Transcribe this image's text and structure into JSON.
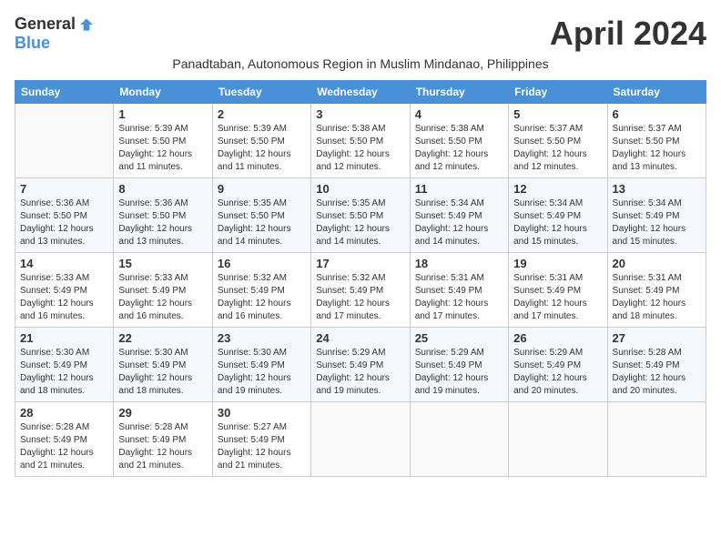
{
  "logo": {
    "general": "General",
    "blue": "Blue"
  },
  "header": {
    "month": "April 2024",
    "subtitle": "Panadtaban, Autonomous Region in Muslim Mindanao, Philippines"
  },
  "weekdays": [
    "Sunday",
    "Monday",
    "Tuesday",
    "Wednesday",
    "Thursday",
    "Friday",
    "Saturday"
  ],
  "weeks": [
    [
      null,
      {
        "day": 1,
        "sunrise": "5:39 AM",
        "sunset": "5:50 PM",
        "daylight": "12 hours and 11 minutes."
      },
      {
        "day": 2,
        "sunrise": "5:39 AM",
        "sunset": "5:50 PM",
        "daylight": "12 hours and 11 minutes."
      },
      {
        "day": 3,
        "sunrise": "5:38 AM",
        "sunset": "5:50 PM",
        "daylight": "12 hours and 12 minutes."
      },
      {
        "day": 4,
        "sunrise": "5:38 AM",
        "sunset": "5:50 PM",
        "daylight": "12 hours and 12 minutes."
      },
      {
        "day": 5,
        "sunrise": "5:37 AM",
        "sunset": "5:50 PM",
        "daylight": "12 hours and 12 minutes."
      },
      {
        "day": 6,
        "sunrise": "5:37 AM",
        "sunset": "5:50 PM",
        "daylight": "12 hours and 13 minutes."
      }
    ],
    [
      {
        "day": 7,
        "sunrise": "5:36 AM",
        "sunset": "5:50 PM",
        "daylight": "12 hours and 13 minutes."
      },
      {
        "day": 8,
        "sunrise": "5:36 AM",
        "sunset": "5:50 PM",
        "daylight": "12 hours and 13 minutes."
      },
      {
        "day": 9,
        "sunrise": "5:35 AM",
        "sunset": "5:50 PM",
        "daylight": "12 hours and 14 minutes."
      },
      {
        "day": 10,
        "sunrise": "5:35 AM",
        "sunset": "5:50 PM",
        "daylight": "12 hours and 14 minutes."
      },
      {
        "day": 11,
        "sunrise": "5:34 AM",
        "sunset": "5:49 PM",
        "daylight": "12 hours and 14 minutes."
      },
      {
        "day": 12,
        "sunrise": "5:34 AM",
        "sunset": "5:49 PM",
        "daylight": "12 hours and 15 minutes."
      },
      {
        "day": 13,
        "sunrise": "5:34 AM",
        "sunset": "5:49 PM",
        "daylight": "12 hours and 15 minutes."
      }
    ],
    [
      {
        "day": 14,
        "sunrise": "5:33 AM",
        "sunset": "5:49 PM",
        "daylight": "12 hours and 16 minutes."
      },
      {
        "day": 15,
        "sunrise": "5:33 AM",
        "sunset": "5:49 PM",
        "daylight": "12 hours and 16 minutes."
      },
      {
        "day": 16,
        "sunrise": "5:32 AM",
        "sunset": "5:49 PM",
        "daylight": "12 hours and 16 minutes."
      },
      {
        "day": 17,
        "sunrise": "5:32 AM",
        "sunset": "5:49 PM",
        "daylight": "12 hours and 17 minutes."
      },
      {
        "day": 18,
        "sunrise": "5:31 AM",
        "sunset": "5:49 PM",
        "daylight": "12 hours and 17 minutes."
      },
      {
        "day": 19,
        "sunrise": "5:31 AM",
        "sunset": "5:49 PM",
        "daylight": "12 hours and 17 minutes."
      },
      {
        "day": 20,
        "sunrise": "5:31 AM",
        "sunset": "5:49 PM",
        "daylight": "12 hours and 18 minutes."
      }
    ],
    [
      {
        "day": 21,
        "sunrise": "5:30 AM",
        "sunset": "5:49 PM",
        "daylight": "12 hours and 18 minutes."
      },
      {
        "day": 22,
        "sunrise": "5:30 AM",
        "sunset": "5:49 PM",
        "daylight": "12 hours and 18 minutes."
      },
      {
        "day": 23,
        "sunrise": "5:30 AM",
        "sunset": "5:49 PM",
        "daylight": "12 hours and 19 minutes."
      },
      {
        "day": 24,
        "sunrise": "5:29 AM",
        "sunset": "5:49 PM",
        "daylight": "12 hours and 19 minutes."
      },
      {
        "day": 25,
        "sunrise": "5:29 AM",
        "sunset": "5:49 PM",
        "daylight": "12 hours and 19 minutes."
      },
      {
        "day": 26,
        "sunrise": "5:29 AM",
        "sunset": "5:49 PM",
        "daylight": "12 hours and 20 minutes."
      },
      {
        "day": 27,
        "sunrise": "5:28 AM",
        "sunset": "5:49 PM",
        "daylight": "12 hours and 20 minutes."
      }
    ],
    [
      {
        "day": 28,
        "sunrise": "5:28 AM",
        "sunset": "5:49 PM",
        "daylight": "12 hours and 21 minutes."
      },
      {
        "day": 29,
        "sunrise": "5:28 AM",
        "sunset": "5:49 PM",
        "daylight": "12 hours and 21 minutes."
      },
      {
        "day": 30,
        "sunrise": "5:27 AM",
        "sunset": "5:49 PM",
        "daylight": "12 hours and 21 minutes."
      },
      null,
      null,
      null,
      null
    ]
  ]
}
